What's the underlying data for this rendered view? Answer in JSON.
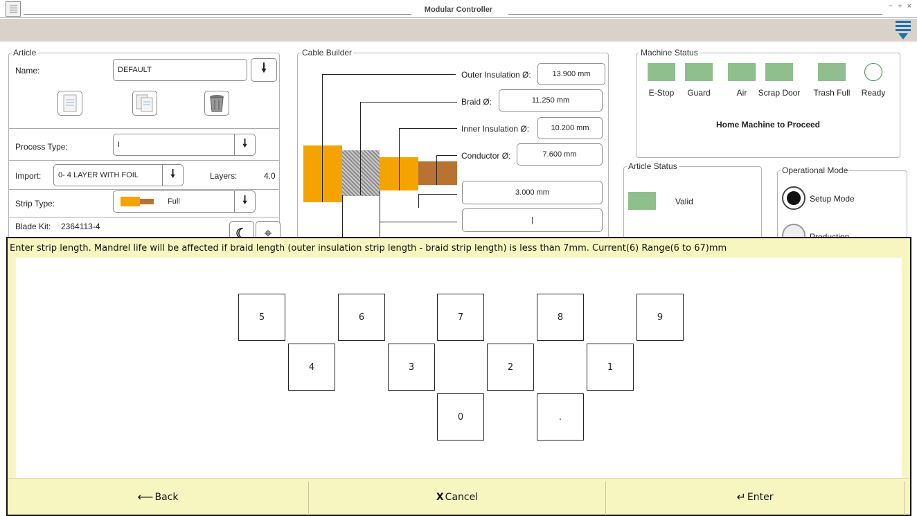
{
  "window": {
    "title": "Modular Controller",
    "controls": "− + ×"
  },
  "article": {
    "group_title": "Article",
    "name_label": "Name:",
    "name_value": "DEFAULT",
    "process_type_label": "Process Type:",
    "process_type_value": "I",
    "import_label": "Import:",
    "import_value": "0- 4 LAYER WITH FOIL",
    "layers_label": "Layers:",
    "layers_value": "4.0",
    "strip_type_label": "Strip Type:",
    "strip_type_value": "Full",
    "blade_kit_label": "Blade Kit:",
    "blade_kit_value": "2364113-4"
  },
  "cable_builder": {
    "group_title": "Cable Builder",
    "outer_label": "Outer Insulation Ø:",
    "outer_value": "13.900 mm",
    "braid_label": "Braid Ø:",
    "braid_value": "11.250 mm",
    "inner_label": "Inner Insulation Ø:",
    "inner_value": "10.200 mm",
    "conductor_label": "Conductor Ø:",
    "conductor_value": "7.600 mm",
    "length_value": "3.000 mm",
    "length2_value": "|"
  },
  "machine_status": {
    "group_title": "Machine Status",
    "indicators": [
      "E-Stop",
      "Guard",
      "Air",
      "Scrap Door",
      "Trash Full",
      "Ready"
    ],
    "message": "Home Machine to Proceed"
  },
  "article_status": {
    "group_title": "Article Status",
    "value": "Valid"
  },
  "operational_mode": {
    "group_title": "Operational Mode",
    "setup": "Setup Mode",
    "production": "Production"
  },
  "keypad": {
    "prompt": "Enter strip length. Mandrel life will be affected if braid length (outer insulation strip length - braid strip length) is less than 7mm.   Current(6)   Range(6 to 67)mm",
    "row1": [
      "5",
      "6",
      "7",
      "8",
      "9"
    ],
    "row2": [
      "4",
      "3",
      "2",
      "1"
    ],
    "row3": [
      "0",
      "."
    ],
    "back_label": "Back",
    "cancel_label": "Cancel",
    "enter_label": "Enter"
  },
  "colors": {
    "status_green": "#8fbf8c",
    "prompt_bg": "#f8f6c0",
    "insulation_orange": "#f5a300",
    "conductor_brown": "#b87333"
  }
}
